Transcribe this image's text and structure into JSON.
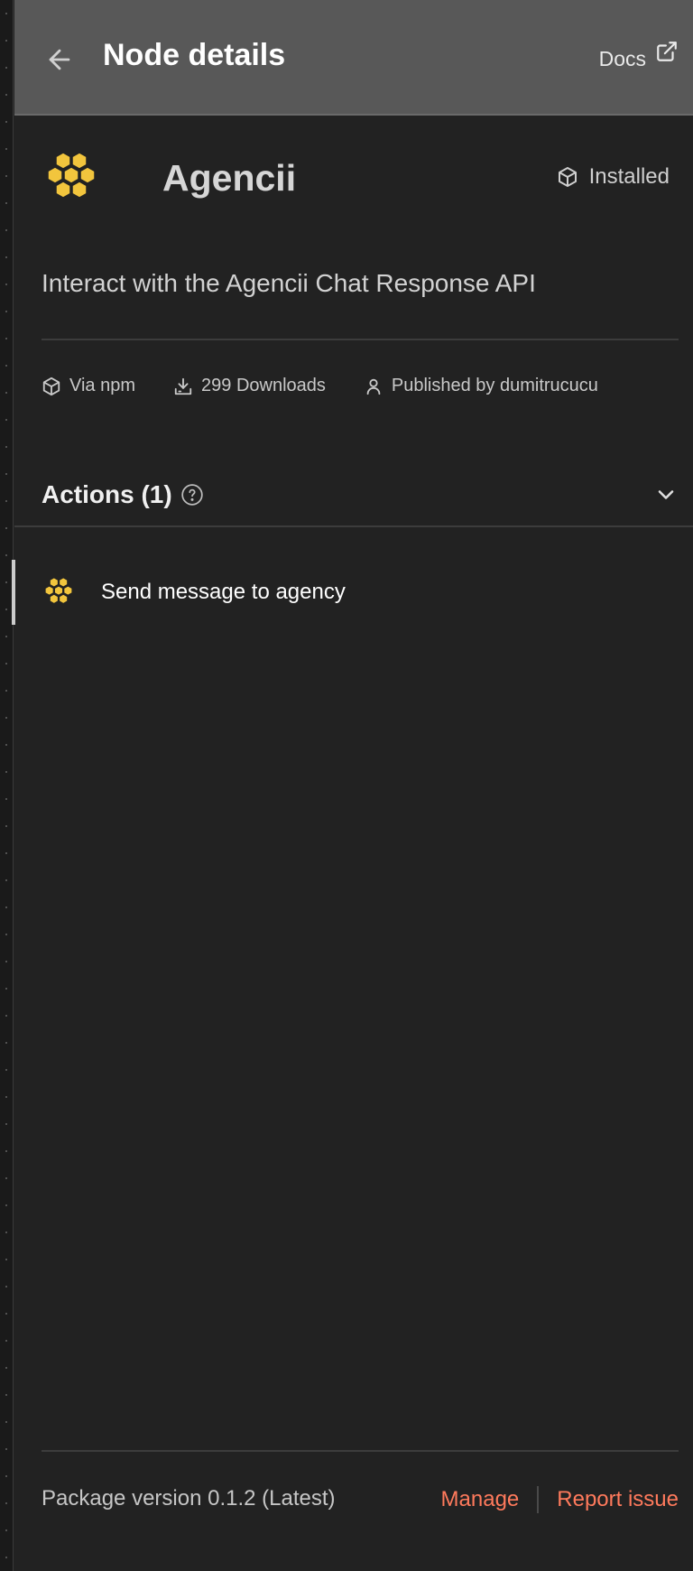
{
  "header": {
    "title": "Node details",
    "back_icon": "arrow-left-icon",
    "docs_label": "Docs",
    "docs_icon": "external-link-icon"
  },
  "node": {
    "name": "Agencii",
    "logo_icon": "honeycomb-logo-icon",
    "logo_color": "#F2C53D",
    "status": "Installed",
    "status_icon": "package-icon",
    "description": "Interact with the Agencii Chat Response API"
  },
  "meta": {
    "source": "Via npm",
    "downloads": "299 Downloads",
    "publisher": "Published by dumitrucucu"
  },
  "actions": {
    "title": "Actions (1)",
    "items": [
      {
        "label": "Send message to agency",
        "icon": "honeycomb-logo-icon"
      }
    ]
  },
  "footer": {
    "version": "Package version 0.1.2 (Latest)",
    "manage": "Manage",
    "report": "Report issue",
    "link_color": "#FF7A5C"
  }
}
